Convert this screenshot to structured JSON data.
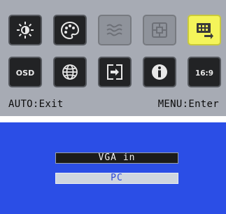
{
  "osd_menu": {
    "icons": [
      {
        "name": "brightness-icon",
        "state": "normal"
      },
      {
        "name": "color-icon",
        "state": "normal"
      },
      {
        "name": "wave-icon",
        "state": "disabled"
      },
      {
        "name": "position-icon",
        "state": "disabled"
      },
      {
        "name": "input-source-icon",
        "state": "selected"
      },
      {
        "name": "osd-settings-icon",
        "state": "normal"
      },
      {
        "name": "language-globe-icon",
        "state": "normal"
      },
      {
        "name": "reset-icon",
        "state": "normal"
      },
      {
        "name": "info-icon",
        "state": "normal"
      },
      {
        "name": "aspect-ratio-icon",
        "state": "normal"
      }
    ],
    "osd_icon_text": "OSD",
    "aspect_icon_text": "16:9",
    "footer_left": "AUTO:Exit",
    "footer_right": "MENU:Enter"
  },
  "source_screen": {
    "title": "VGA in",
    "selected_option": "PC"
  },
  "colors": {
    "osd_background": "#a7abb4",
    "tile": "#222325",
    "tile_disabled": "#8f939b",
    "tile_selected": "#f4f45a",
    "screen_background": "#2b4ee6",
    "option_highlight": "#cfd6df"
  }
}
